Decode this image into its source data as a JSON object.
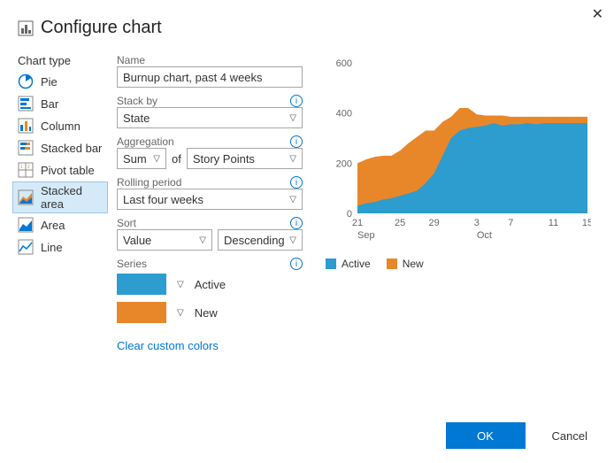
{
  "title": "Configure chart",
  "sidebar": {
    "label": "Chart type",
    "items": [
      {
        "label": "Pie"
      },
      {
        "label": "Bar"
      },
      {
        "label": "Column"
      },
      {
        "label": "Stacked bar"
      },
      {
        "label": "Pivot table"
      },
      {
        "label": "Stacked area"
      },
      {
        "label": "Area"
      },
      {
        "label": "Line"
      }
    ],
    "selected_index": 5
  },
  "fields": {
    "name_label": "Name",
    "name_value": "Burnup chart, past 4 weeks",
    "stack_by_label": "Stack by",
    "stack_by_value": "State",
    "aggregation_label": "Aggregation",
    "aggregation_value": "Sum",
    "of_label": "of",
    "aggregation_field_value": "Story Points",
    "rolling_label": "Rolling period",
    "rolling_value": "Last four weeks",
    "sort_label": "Sort",
    "sort_by_value": "Value",
    "sort_dir_value": "Descending",
    "series_label": "Series",
    "series": [
      {
        "name": "Active",
        "color": "#2d9cce"
      },
      {
        "name": "New",
        "color": "#e8872a"
      }
    ],
    "clear_colors_label": "Clear custom colors"
  },
  "footer": {
    "ok_label": "OK",
    "cancel_label": "Cancel"
  },
  "chart_data": {
    "type": "area",
    "stacked": true,
    "ylim": [
      0,
      600
    ],
    "yticks": [
      0,
      200,
      400,
      600
    ],
    "x_labels": [
      "21",
      "25",
      "29",
      "3",
      "7",
      "11",
      "15"
    ],
    "x_month_labels": [
      "Sep",
      "Oct"
    ],
    "series": [
      {
        "name": "Active",
        "color": "#2d9cce",
        "values": [
          30,
          40,
          45,
          55,
          60,
          70,
          80,
          90,
          120,
          160,
          230,
          300,
          330,
          340,
          345,
          350,
          360,
          350,
          355,
          355,
          360,
          355,
          360,
          360,
          360,
          360,
          360,
          360
        ]
      },
      {
        "name": "New",
        "color": "#e8872a",
        "values": [
          170,
          175,
          180,
          175,
          170,
          180,
          200,
          215,
          210,
          170,
          135,
          85,
          90,
          80,
          50,
          40,
          30,
          40,
          30,
          30,
          25,
          30,
          25,
          25,
          25,
          25,
          25,
          25
        ]
      }
    ],
    "legend": [
      "Active",
      "New"
    ]
  }
}
